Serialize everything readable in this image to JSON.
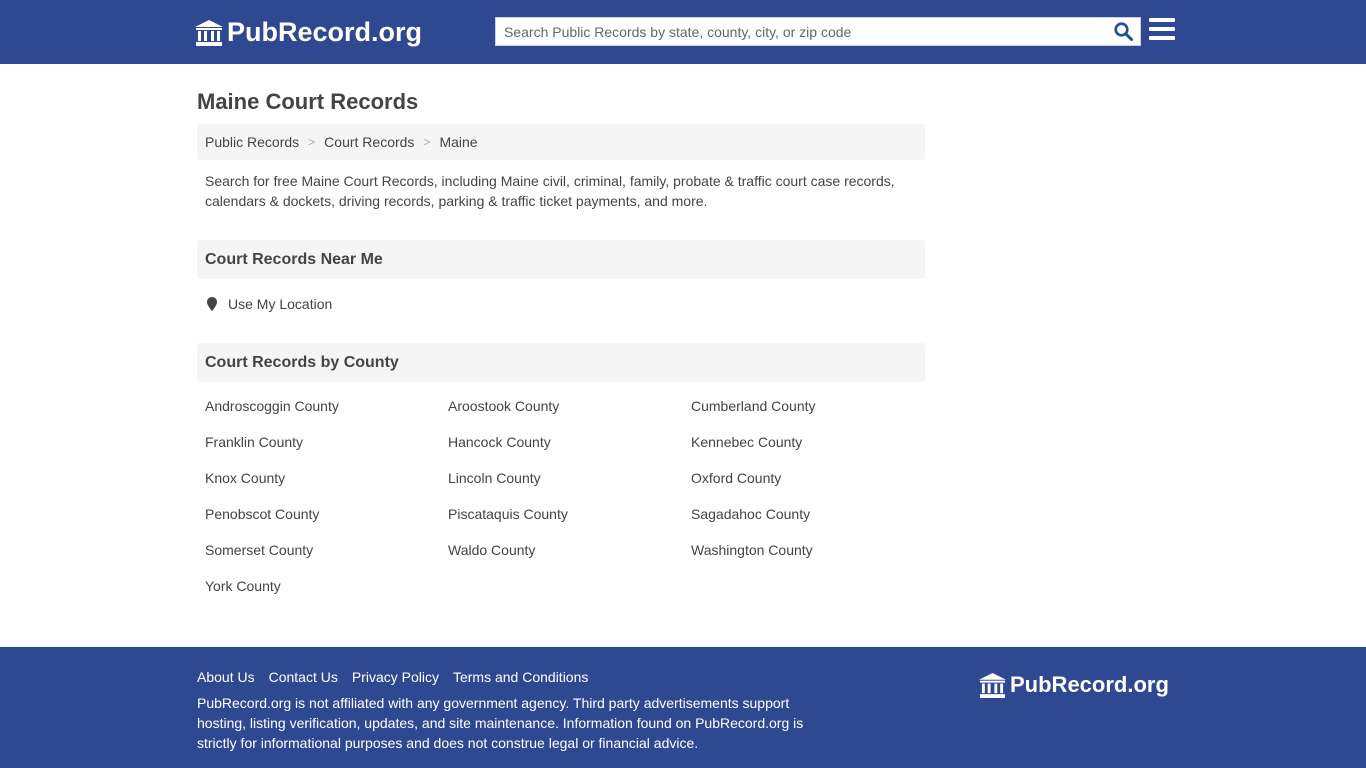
{
  "header": {
    "logo_text": "PubRecord.org",
    "search_placeholder": "Search Public Records by state, county, city, or zip code"
  },
  "page": {
    "title": "Maine Court Records",
    "breadcrumb": [
      "Public Records",
      "Court Records",
      "Maine"
    ],
    "intro": "Search for free Maine Court Records, including Maine civil, criminal, family, probate & traffic court case records, calendars & dockets, driving records, parking & traffic ticket payments, and more."
  },
  "near_me": {
    "heading": "Court Records Near Me",
    "location_label": "Use My Location"
  },
  "counties": {
    "heading": "Court Records by County",
    "items": [
      "Androscoggin County",
      "Aroostook County",
      "Cumberland County",
      "Franklin County",
      "Hancock County",
      "Kennebec County",
      "Knox County",
      "Lincoln County",
      "Oxford County",
      "Penobscot County",
      "Piscataquis County",
      "Sagadahoc County",
      "Somerset County",
      "Waldo County",
      "Washington County",
      "York County"
    ]
  },
  "footer": {
    "links": [
      "About Us",
      "Contact Us",
      "Privacy Policy",
      "Terms and Conditions"
    ],
    "disclaimer": "PubRecord.org is not affiliated with any government agency. Third party advertisements support hosting, listing verification, updates, and site maintenance. Information found on PubRecord.org is strictly for informational purposes and does not construe legal or financial advice.",
    "logo_text": "PubRecord.org"
  },
  "colors": {
    "brand_blue": "#2f4892",
    "search_icon": "#1f4f96",
    "panel_gray": "#f5f5f5"
  }
}
